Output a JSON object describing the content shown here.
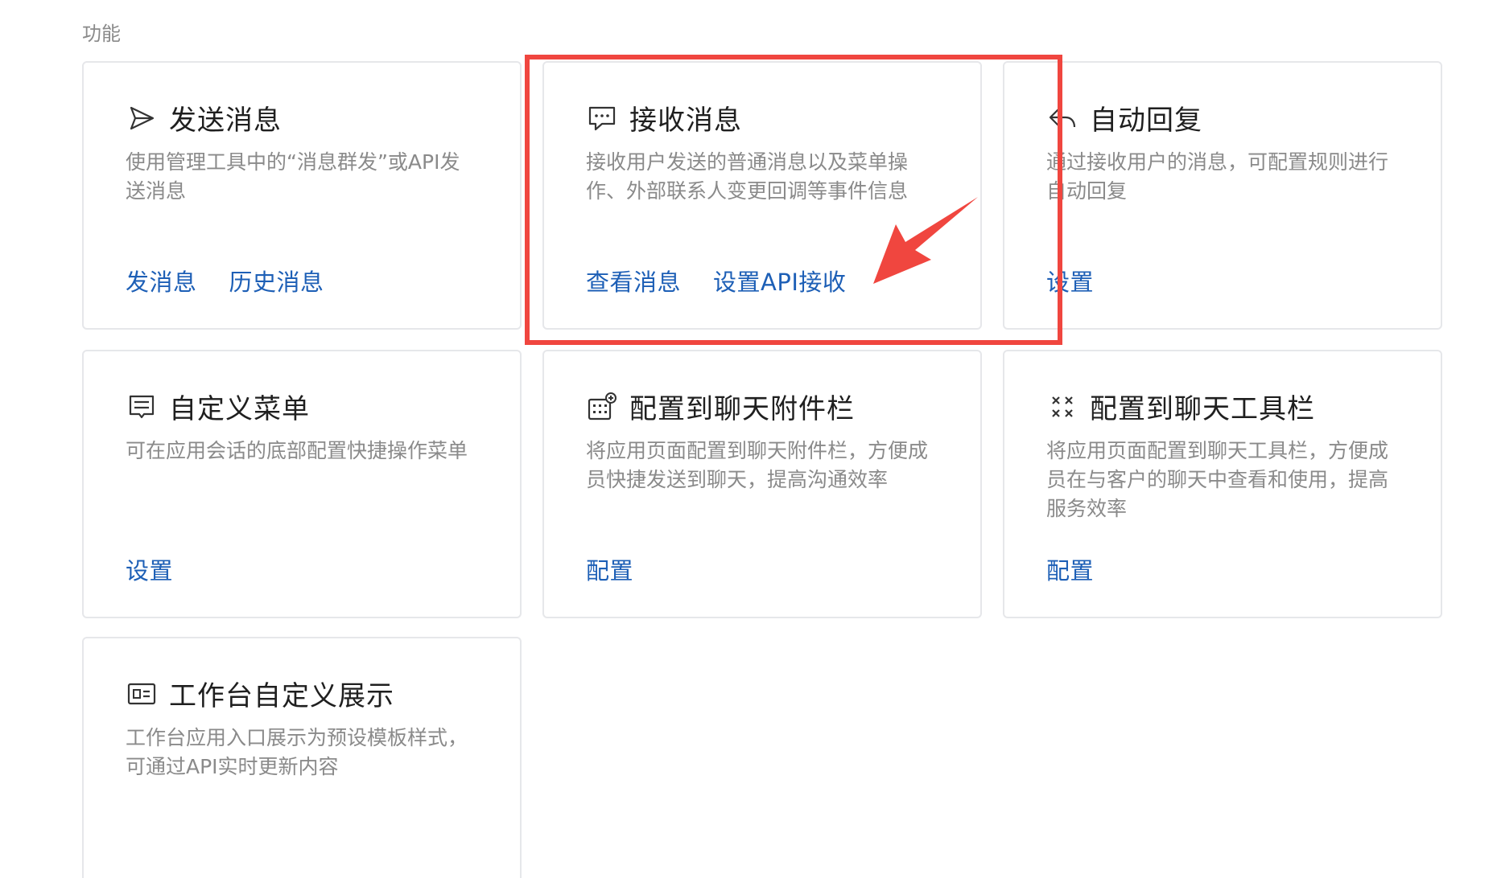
{
  "section": {
    "label": "功能"
  },
  "cards": [
    {
      "title": "发送消息",
      "icon": "send-icon",
      "desc": "使用管理工具中的“消息群发”或API发送消息",
      "actions": [
        "发消息",
        "历史消息"
      ]
    },
    {
      "title": "接收消息",
      "icon": "chat-bubble-icon",
      "desc": "接收用户发送的普通消息以及菜单操作、外部联系人变更回调等事件信息",
      "actions": [
        "查看消息",
        "设置API接收"
      ]
    },
    {
      "title": "自动回复",
      "icon": "reply-icon",
      "desc": "通过接收用户的消息，可配置规则进行自动回复",
      "actions": [
        "设置"
      ]
    },
    {
      "title": "自定义菜单",
      "icon": "menu-icon",
      "desc": "可在应用会话的底部配置快捷操作菜单",
      "actions": [
        "设置"
      ]
    },
    {
      "title": "配置到聊天附件栏",
      "icon": "attachment-bar-icon",
      "desc": "将应用页面配置到聊天附件栏，方便成员快捷发送到聊天，提高沟通效率",
      "actions": [
        "配置"
      ]
    },
    {
      "title": "配置到聊天工具栏",
      "icon": "toolbar-icon",
      "desc": "将应用页面配置到聊天工具栏，方便成员在与客户的聊天中查看和使用，提高服务效率",
      "actions": [
        "配置"
      ]
    },
    {
      "title": "工作台自定义展示",
      "icon": "workbench-card-icon",
      "desc": "工作台应用入口展示为预设模板样式，可通过API实时更新内容",
      "actions": []
    }
  ],
  "colors": {
    "link": "#1d5fb6",
    "highlight": "#f0463f",
    "title": "#1f1f1f",
    "desc": "#8a8a8a",
    "border": "#e6e7ea"
  }
}
